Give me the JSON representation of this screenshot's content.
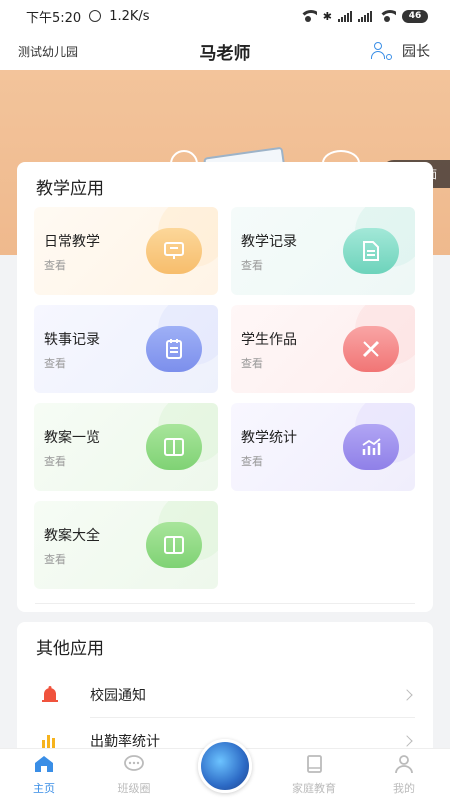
{
  "status_bar": {
    "time": "下午5:20",
    "speed": "1.2K/s",
    "battery": "46"
  },
  "header": {
    "school": "测试幼儿园",
    "title": "马老师",
    "role": "园长"
  },
  "banner": {
    "change_cover": "更换封面"
  },
  "teaching_apps": {
    "title": "教学应用",
    "tiles": [
      {
        "label": "日常教学",
        "sub": "查看",
        "icon": "board-icon",
        "color": "#f7bd6c"
      },
      {
        "label": "教学记录",
        "sub": "查看",
        "icon": "document-icon",
        "color": "#6dd3bb"
      },
      {
        "label": "轶事记录",
        "sub": "查看",
        "icon": "clipboard-icon",
        "color": "#7c8fec"
      },
      {
        "label": "学生作品",
        "sub": "查看",
        "icon": "pencil-ruler-icon",
        "color": "#f17575"
      },
      {
        "label": "教案一览",
        "sub": "查看",
        "icon": "book-icon",
        "color": "#7fd274"
      },
      {
        "label": "教学统计",
        "sub": "查看",
        "icon": "bar-chart-icon",
        "color": "#8f80e8"
      },
      {
        "label": "教案大全",
        "sub": "查看",
        "icon": "book-icon",
        "color": "#7fd274"
      }
    ]
  },
  "other_apps": {
    "title": "其他应用",
    "items": [
      {
        "label": "校园通知",
        "icon": "bell-icon",
        "color": "#f0533d"
      },
      {
        "label": "出勤率统计",
        "icon": "bar-chart-icon",
        "color": "#f6b31d"
      }
    ]
  },
  "nav": {
    "items": [
      {
        "label": "主页",
        "icon": "home-icon",
        "active": true
      },
      {
        "label": "班级圈",
        "icon": "chat-icon",
        "active": false
      },
      {
        "label": "家庭教育",
        "icon": "book-icon",
        "active": false
      },
      {
        "label": "我的",
        "icon": "person-icon",
        "active": false
      }
    ]
  }
}
